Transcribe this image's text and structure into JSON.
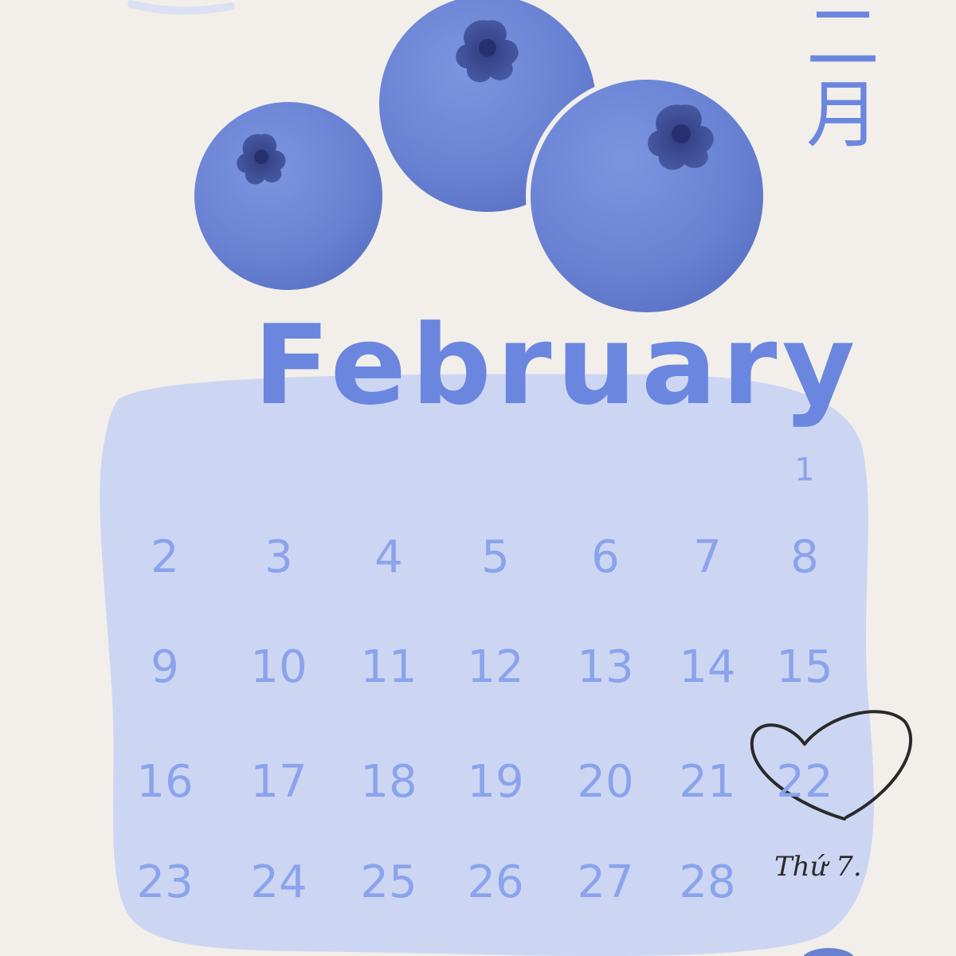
{
  "calendar": {
    "month_name": "February",
    "month_name_cjk": "二月",
    "days": [
      1,
      2,
      3,
      4,
      5,
      6,
      7,
      8,
      9,
      10,
      11,
      12,
      13,
      14,
      15,
      16,
      17,
      18,
      19,
      20,
      21,
      22,
      23,
      24,
      25,
      26,
      27,
      28
    ],
    "first_day_column": 7,
    "highlighted_day": 22,
    "highlight_note": "Thứ 7."
  },
  "decorations": {
    "fruit": "blueberry",
    "fruit_count": 3,
    "highlight_mark": "heart-icon"
  },
  "colors": {
    "paper": "#f2efea",
    "blob": "#ccd6f3",
    "text_blue": "#6b86df",
    "number_blue": "#8ba3ec",
    "berry": "#6f88d6",
    "berry_dark": "#3d4f9c",
    "heart_ink": "#2a2a2a"
  }
}
